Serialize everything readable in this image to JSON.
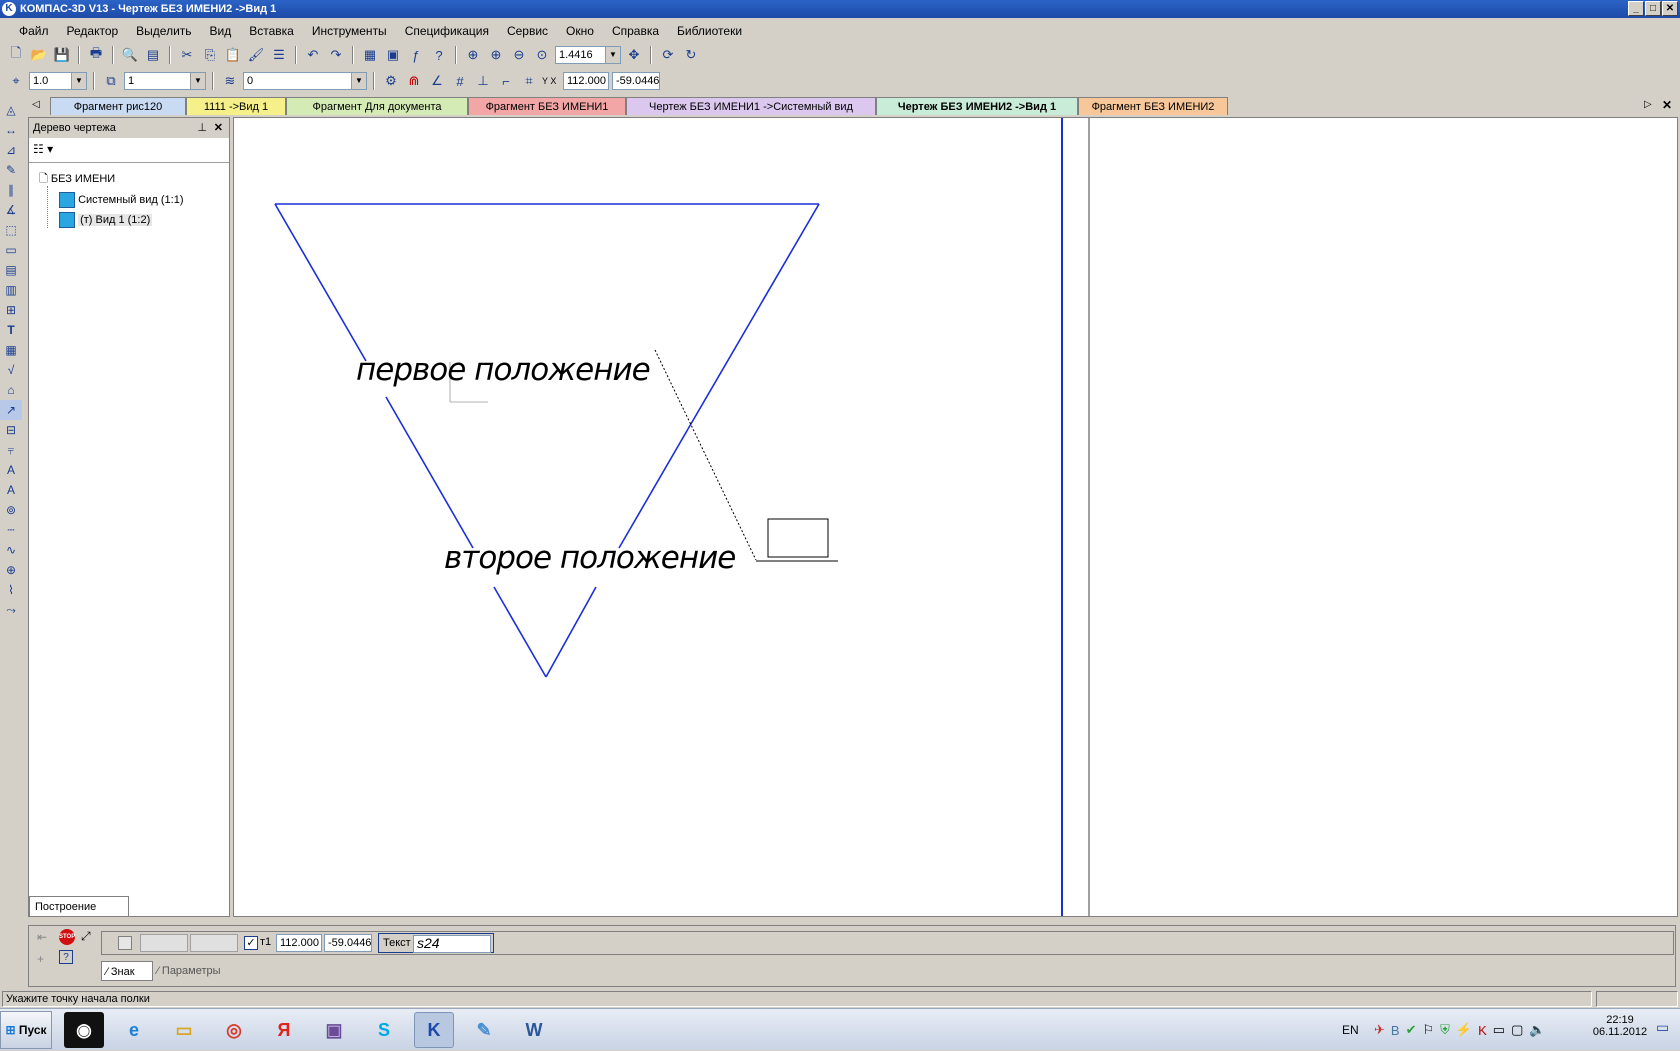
{
  "window": {
    "title": "КОМПАС-3D V13 - Чертеж БЕЗ ИМЕНИ2 ->Вид 1",
    "logo": "K",
    "minimize": "_",
    "maximize": "□",
    "close": "✕"
  },
  "menu": [
    {
      "label": "Файл"
    },
    {
      "label": "Редактор"
    },
    {
      "label": "Выделить"
    },
    {
      "label": "Вид"
    },
    {
      "label": "Вставка"
    },
    {
      "label": "Инструменты"
    },
    {
      "label": "Спецификация"
    },
    {
      "label": "Сервис"
    },
    {
      "label": "Окно"
    },
    {
      "label": "Справка"
    },
    {
      "label": "Библиотеки"
    }
  ],
  "toolbar_main": {
    "zoom_value": "1.4416"
  },
  "toolbar_current": {
    "step_value": "1.0",
    "view_value": "1",
    "layer_value": "0",
    "coord_x": "112.000",
    "coord_y": "-59.0446",
    "xy_label": "Y X"
  },
  "tabs": [
    {
      "label": "Фрагмент рис120",
      "color": "#c9daf3"
    },
    {
      "label": "1111 ->Вид 1",
      "color": "#f6f08a"
    },
    {
      "label": "Фрагмент Для документа",
      "color": "#d5ebb5"
    },
    {
      "label": "Фрагмент БЕЗ ИМЕНИ1",
      "color": "#f3a6a6"
    },
    {
      "label": "Чертеж БЕЗ ИМЕНИ1 ->Системный вид",
      "color": "#dcc8ef"
    },
    {
      "label": "Чертеж БЕЗ ИМЕНИ2 ->Вид 1",
      "color": "#c8ecd8"
    },
    {
      "label": "Фрагмент БЕЗ ИМЕНИ2",
      "color": "#f7c79a"
    }
  ],
  "tree_panel": {
    "title": "Дерево чертежа",
    "root": "БЕЗ ИМЕНИ",
    "items": [
      {
        "label": "Системный вид (1:1)"
      },
      {
        "label": "(т) Вид 1 (1:2)"
      }
    ],
    "footer_tab": "Построение"
  },
  "drawing": {
    "text_first": "первое положение",
    "text_second": "второе положение",
    "line_color": "#1a2fd8"
  },
  "properties": {
    "coord_x": "112.000",
    "coord_y": "-59.0446",
    "t1_label": "т1",
    "text_label": "Текст",
    "text_value": "s24",
    "tab_sign": "Знак",
    "tab_params": "Параметры"
  },
  "status": {
    "message": "Укажите точку начала полки"
  },
  "taskbar": {
    "start_label": "Пуск",
    "lang": "EN",
    "time": "22:19",
    "date": "06.11.2012"
  }
}
